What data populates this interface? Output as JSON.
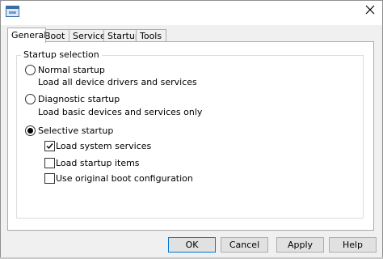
{
  "title_bar": {
    "app_icon": "msconfig-window-icon",
    "close_icon": "close-icon"
  },
  "tabs": [
    {
      "label": "General",
      "active": true
    },
    {
      "label": "Boot",
      "active": false
    },
    {
      "label": "Services",
      "active": false
    },
    {
      "label": "Startup",
      "active": false
    },
    {
      "label": "Tools",
      "active": false
    }
  ],
  "startup_selection": {
    "group_label": "Startup selection",
    "normal": {
      "label": "Normal startup",
      "description": "Load all device drivers and services",
      "selected": false
    },
    "diagnostic": {
      "label": "Diagnostic startup",
      "description": "Load basic devices and services only",
      "selected": false
    },
    "selective": {
      "label": "Selective startup",
      "selected": true
    },
    "options": [
      {
        "label": "Load system services",
        "checked": true
      },
      {
        "label": "Load startup items",
        "checked": false,
        "highlighted": true
      },
      {
        "label": "Use original boot configuration",
        "checked": false
      }
    ]
  },
  "buttons": {
    "ok": "OK",
    "cancel": "Cancel",
    "apply": "Apply",
    "help": "Help"
  },
  "highlights": {
    "color": "#d32020",
    "items": [
      "Load startup items",
      "Apply"
    ]
  },
  "colors": {
    "dialog_background": "#f0f0f0",
    "page_background": "#ffffff",
    "default_button_border": "#0078d7"
  }
}
